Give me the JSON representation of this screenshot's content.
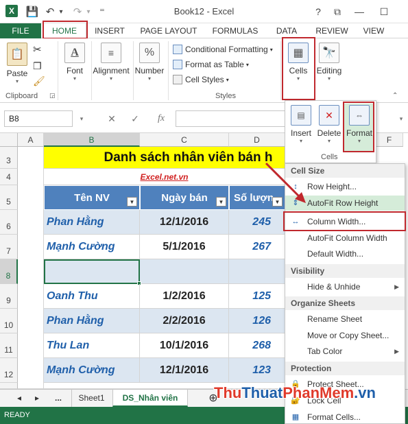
{
  "window": {
    "title": "Book12 - Excel",
    "help": "?",
    "restore": "⧉",
    "minimize": "—",
    "maximize": "☐"
  },
  "qat": {
    "save": "💾",
    "undo": "↶",
    "undo_caret": "▾",
    "redo": "↷",
    "redo_caret": "▾",
    "customize": "⁼"
  },
  "app_icon": "X",
  "tabs": [
    "FILE",
    "HOME",
    "INSERT",
    "PAGE LAYOUT",
    "FORMULAS",
    "DATA",
    "REVIEW",
    "VIEW"
  ],
  "ribbon": {
    "paste": "Paste",
    "clipboard_label": "Clipboard",
    "font": "Font",
    "alignment": "Alignment",
    "number": "Number",
    "conditional_formatting": "Conditional Formatting",
    "format_as_table": "Format as Table",
    "cell_styles": "Cell Styles",
    "styles_label": "Styles",
    "cells": "Cells",
    "editing": "Editing"
  },
  "cells_dropdown": {
    "insert": "Insert",
    "delete": "Delete",
    "format": "Format",
    "label": "Cells"
  },
  "formula_bar": {
    "name_box": "B8",
    "cancel": "✕",
    "enter": "✓",
    "fx": "fx"
  },
  "columns": [
    "A",
    "B",
    "C",
    "D",
    "F"
  ],
  "rows": [
    "3",
    "4",
    "5",
    "6",
    "7",
    "8",
    "9",
    "10",
    "11",
    "12"
  ],
  "sheet": {
    "title": "Danh sách nhân viên bán h",
    "subtitle": "Excel.net.vn",
    "headers": [
      "Tên NV",
      "Ngày bán",
      "Số lượn"
    ],
    "data": [
      {
        "name": "Phan Hằng",
        "date": "12/1/2016",
        "qty": "245"
      },
      {
        "name": "Mạnh Cường",
        "date": "5/1/2016",
        "qty": "267"
      },
      {
        "name": "",
        "date": "",
        "qty": ""
      },
      {
        "name": "Oanh Thu",
        "date": "1/2/2016",
        "qty": "125"
      },
      {
        "name": "Phan Hằng",
        "date": "2/2/2016",
        "qty": "126"
      },
      {
        "name": "Thu Lan",
        "date": "10/1/2016",
        "qty": "268"
      },
      {
        "name": "Mạnh Cường",
        "date": "12/1/2016",
        "qty": "123"
      }
    ]
  },
  "sheet_tabs": {
    "prev": "◂",
    "next": "▸",
    "more": "...",
    "sheet1": "Sheet1",
    "active": "DS_Nhân viên",
    "add": "⊕"
  },
  "status": {
    "ready": "READY"
  },
  "format_menu": {
    "cell_size": "Cell Size",
    "row_height": "Row Height...",
    "autofit_row": "AutoFit Row Height",
    "column_width": "Column Width...",
    "autofit_column": "AutoFit Column Width",
    "default_width": "Default Width...",
    "visibility": "Visibility",
    "hide_unhide": "Hide & Unhide",
    "organize": "Organize Sheets",
    "rename": "Rename Sheet",
    "move_copy": "Move or Copy Sheet...",
    "tab_color": "Tab Color",
    "protection": "Protection",
    "protect_sheet": "Protect Sheet...",
    "lock_cell": "Lock Cell",
    "format_cells": "Format Cells..."
  },
  "watermark": {
    "part1": "Thu",
    "part2": "Thuat",
    "part3": "PhanMem",
    "part4": ".vn"
  },
  "colors": {
    "excel_green": "#217346",
    "header_blue": "#4f81bd",
    "highlight_red": "#c0282d",
    "title_yellow": "#ffff00"
  }
}
